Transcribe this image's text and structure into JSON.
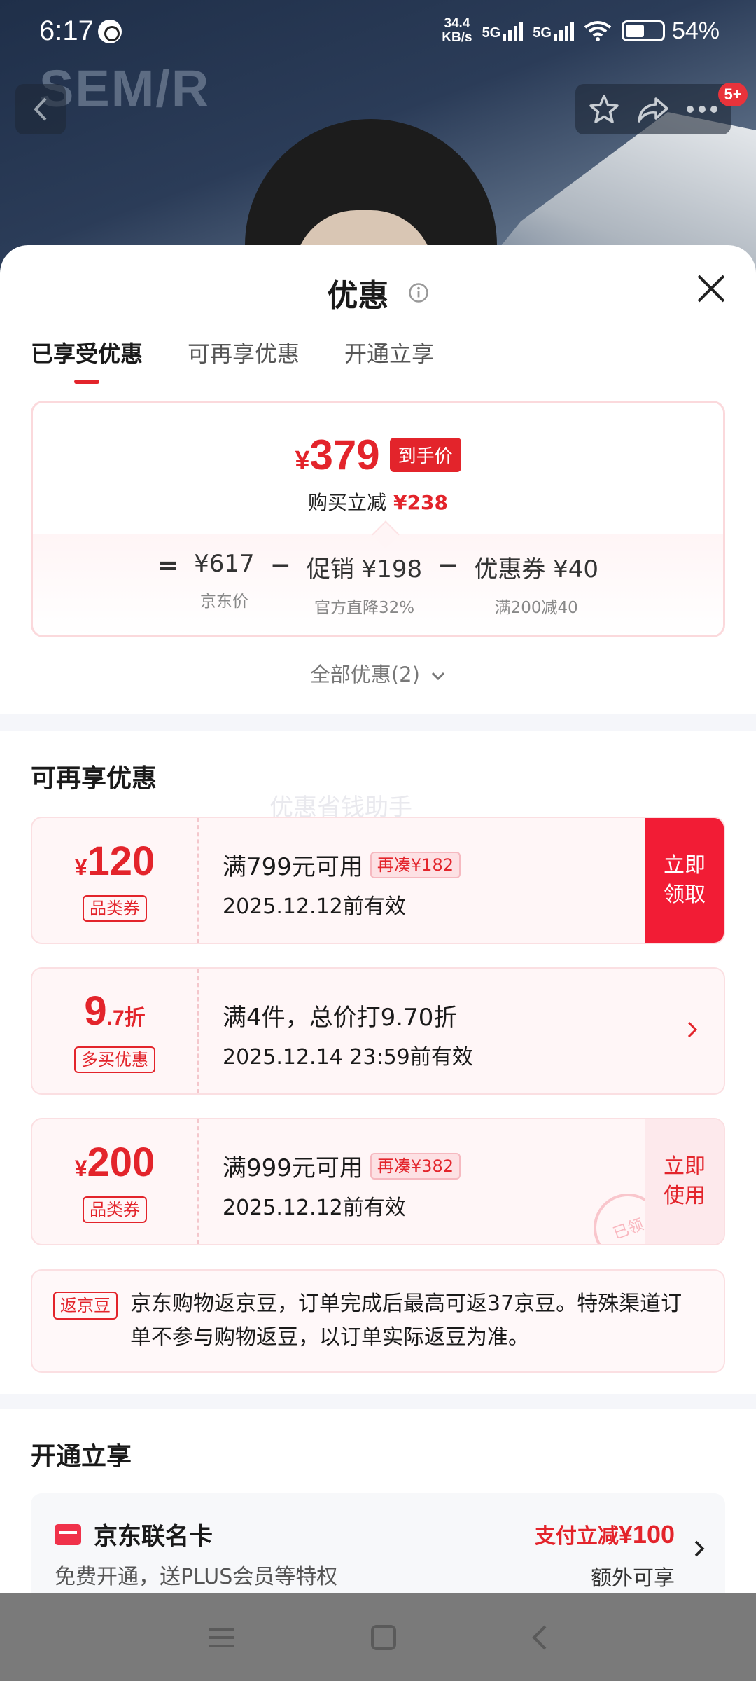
{
  "status_bar": {
    "time": "6:17",
    "net_speed_top": "34.4",
    "net_speed_bottom": "KB/s",
    "sim1": "5G",
    "sim2": "5G",
    "battery": "54%"
  },
  "header": {
    "brand": "SEM/R",
    "badge": "5+"
  },
  "sheet": {
    "title": "优惠",
    "tabs": [
      "已享受优惠",
      "可再享优惠",
      "开通立享"
    ],
    "active_tab": 0
  },
  "price_summary": {
    "final_price": "379",
    "final_currency": "¥",
    "final_tag": "到手价",
    "reduce_label": "购买立减",
    "reduce_value": "¥238",
    "eq": "=",
    "minus": "−",
    "jd_price": "¥617",
    "jd_price_label": "京东价",
    "promo": "促销 ¥198",
    "promo_label": "官方直降32%",
    "coupon": "优惠券 ¥40",
    "coupon_label": "满200减40"
  },
  "all_offers": "全部优惠(2)",
  "section_more": {
    "title": "可再享优惠",
    "watermark": "优惠省钱助手"
  },
  "coupons": [
    {
      "currency": "¥",
      "amount": "120",
      "tag": "品类券",
      "condition": "满799元可用",
      "extra": "再凑¥182",
      "valid": "2025.12.12前有效",
      "action_line1": "立即",
      "action_line2": "领取"
    },
    {
      "amount_main": "9",
      "amount_small": ".7折",
      "tag": "多买优惠",
      "condition": "满4件，总价打9.70折",
      "valid": "2025.12.14 23:59前有效"
    },
    {
      "currency": "¥",
      "amount": "200",
      "tag": "品类券",
      "condition": "满999元可用",
      "extra": "再凑¥382",
      "valid": "2025.12.12前有效",
      "action_line1": "立即",
      "action_line2": "使用",
      "stamp": "已领"
    }
  ],
  "bean": {
    "tag": "返京豆",
    "text": "京东购物返京豆，订单完成后最高可返37京豆。特殊渠道订单不参与购物返豆，以订单实际返豆为准。"
  },
  "section_open": {
    "title": "开通立享"
  },
  "card": {
    "name": "京东联名卡",
    "desc": "免费开通，送PLUS会员等特权",
    "promo_label": "支付立减",
    "promo_value": "¥100",
    "extra": "额外可享"
  },
  "colors": {
    "accent": "#e3242b",
    "action_red": "#f21c35"
  }
}
